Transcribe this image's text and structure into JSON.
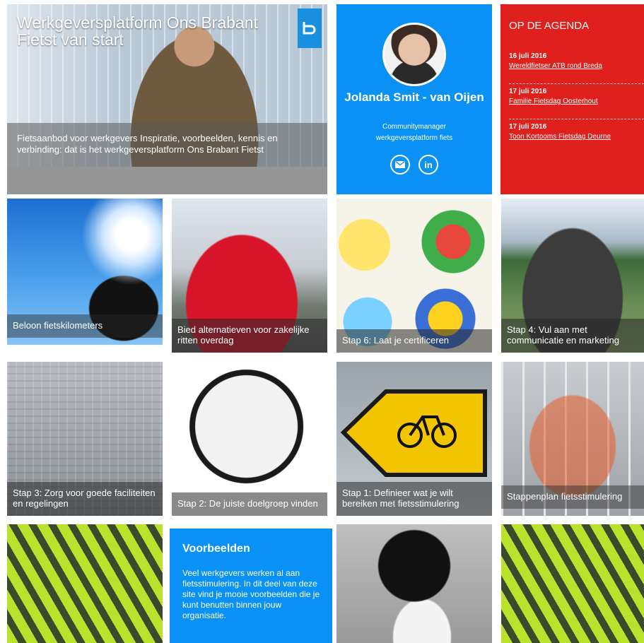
{
  "hero": {
    "title": "Werkgeversplatform Ons Brabant Fietst van start",
    "caption": "Fietsaanbod voor werkgevers Inspiratie, voorbeelden, kennis en verbinding: dat is het werkgeversplatform Ons Brabant Fietst",
    "logo_icon": "brabant-b-logo"
  },
  "profile": {
    "name": "Jolanda Smit - van Oijen",
    "role_line1": "Communitymanager",
    "role_line2": "werkgeversplatform fiets",
    "email_icon": "mail-icon",
    "linkedin_icon": "linkedin-icon",
    "linkedin_label": "in"
  },
  "agenda": {
    "title": "OP DE AGENDA",
    "items": [
      {
        "date": "16 juli 2016",
        "link": "Wereldfietser ATB rond Breda"
      },
      {
        "date": "17 juli 2016",
        "link": "Familie Fietsdag Oosterhout"
      },
      {
        "date": "17 juli 2016",
        "link": "Toon Kortooms Fietsdag Deurne"
      }
    ]
  },
  "tiles": [
    {
      "caption": "Beloon fietskilometers"
    },
    {
      "caption": "Bied alternatieven voor zakelijke ritten overdag"
    },
    {
      "caption": "Stap 6: Laat je certificeren"
    },
    {
      "caption": "Stap 4: Vul aan met communicatie en marketing"
    },
    {
      "caption": "Stap 3: Zorg voor goede faciliteiten en regelingen"
    },
    {
      "caption": "Stap 2: De juiste doelgroep vinden"
    },
    {
      "caption": "Stap 1: Definieer wat je wilt bereiken met fietsstimulering"
    },
    {
      "caption": "Stappenplan fietsstimulering"
    }
  ],
  "voorbeelden": {
    "title": "Voorbeelden",
    "text": "Veel werkgevers werken al aan fietsstimulering. In dit deel van deze site vind je mooie voorbeelden die je kunt benutten binnen jouw organisatie."
  },
  "colors": {
    "brand_blue": "#0a91f6",
    "agenda_red": "#e0201c",
    "caption_overlay": "#333333"
  }
}
